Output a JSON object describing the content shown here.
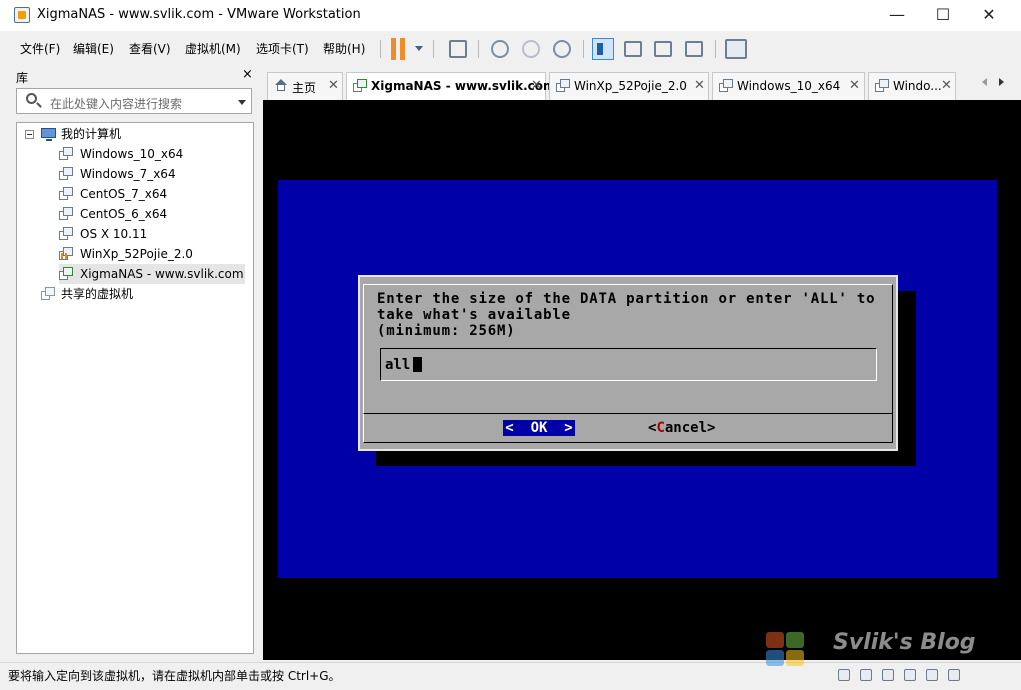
{
  "window": {
    "title": "XigmaNAS - www.svlik.com - VMware Workstation",
    "minimize": "—",
    "maximize": "☐",
    "close": "✕"
  },
  "menu": [
    "文件(F)",
    "编辑(E)",
    "查看(V)",
    "虚拟机(M)",
    "选项卡(T)",
    "帮助(H)"
  ],
  "library": {
    "title": "库",
    "close": "×",
    "search_placeholder": "在此处键入内容进行搜索",
    "root": "我的计算机",
    "vms": [
      "Windows_10_x64",
      "Windows_7_x64",
      "CentOS_7_x64",
      "CentOS_6_x64",
      "OS X 10.11",
      "WinXp_52Pojie_2.0",
      "XigmaNAS - www.svlik.com"
    ],
    "shared": "共享的虚拟机"
  },
  "tabs": [
    {
      "label": "主页",
      "close": "✕"
    },
    {
      "label": "XigmaNAS - www.svlik.com",
      "close": "✕"
    },
    {
      "label": "WinXp_52Pojie_2.0",
      "close": "✕"
    },
    {
      "label": "Windows_10_x64",
      "close": "✕"
    },
    {
      "label": "Windo...",
      "close": "✕"
    }
  ],
  "dialog": {
    "line1": "Enter the size of the DATA partition or enter 'ALL' to",
    "line2": "take what's available",
    "line3": "(minimum: 256M)",
    "input_value": "all",
    "ok_label": "<  OK  >",
    "cancel_open": "<",
    "cancel_hot": "C",
    "cancel_rest": "ancel>"
  },
  "status": {
    "text": "要将输入定向到该虚拟机，请在虚拟机内部单击或按 Ctrl+G。"
  },
  "watermark": "Svlik's Blog",
  "colors": {
    "console_blue": "#0000a8",
    "dialog_gray": "#a8a8a8",
    "hotkey_red": "#a80000",
    "pause_orange": "#ee8d2a"
  }
}
